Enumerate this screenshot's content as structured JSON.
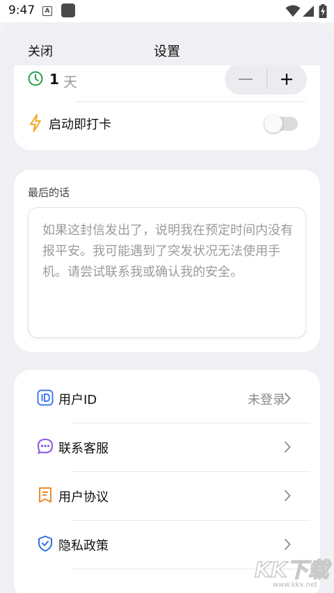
{
  "status": {
    "time": "9:47",
    "badge": "A"
  },
  "header": {
    "close_label": "关闭",
    "title": "设置"
  },
  "days": {
    "value": "1",
    "unit": "天",
    "minus": "−",
    "plus": "+"
  },
  "checkin": {
    "label": "启动即打卡",
    "enabled": false
  },
  "message": {
    "label": "最后的话",
    "placeholder": "如果这封信发出了，说明我在预定时间内没有报平安。我可能遇到了突发状况无法使用手机。请尝试联系我或确认我的安全。"
  },
  "list": [
    {
      "label": "用户ID",
      "value": "未登录",
      "icon": "id-icon",
      "color": "#3d7bf0"
    },
    {
      "label": "联系客服",
      "value": "",
      "icon": "chat-icon",
      "color": "#8a55e8"
    },
    {
      "label": "用户协议",
      "value": "",
      "icon": "document-icon",
      "color": "#f08a2a"
    },
    {
      "label": "隐私政策",
      "value": "",
      "icon": "shield-icon",
      "color": "#2f6fe0"
    }
  ],
  "watermark": {
    "text": "KK下载",
    "url": "www.kkx.net"
  },
  "colors": {
    "accent_green": "#21a14a",
    "bolt_orange": "#f5a623",
    "background": "#f0f0f4"
  }
}
